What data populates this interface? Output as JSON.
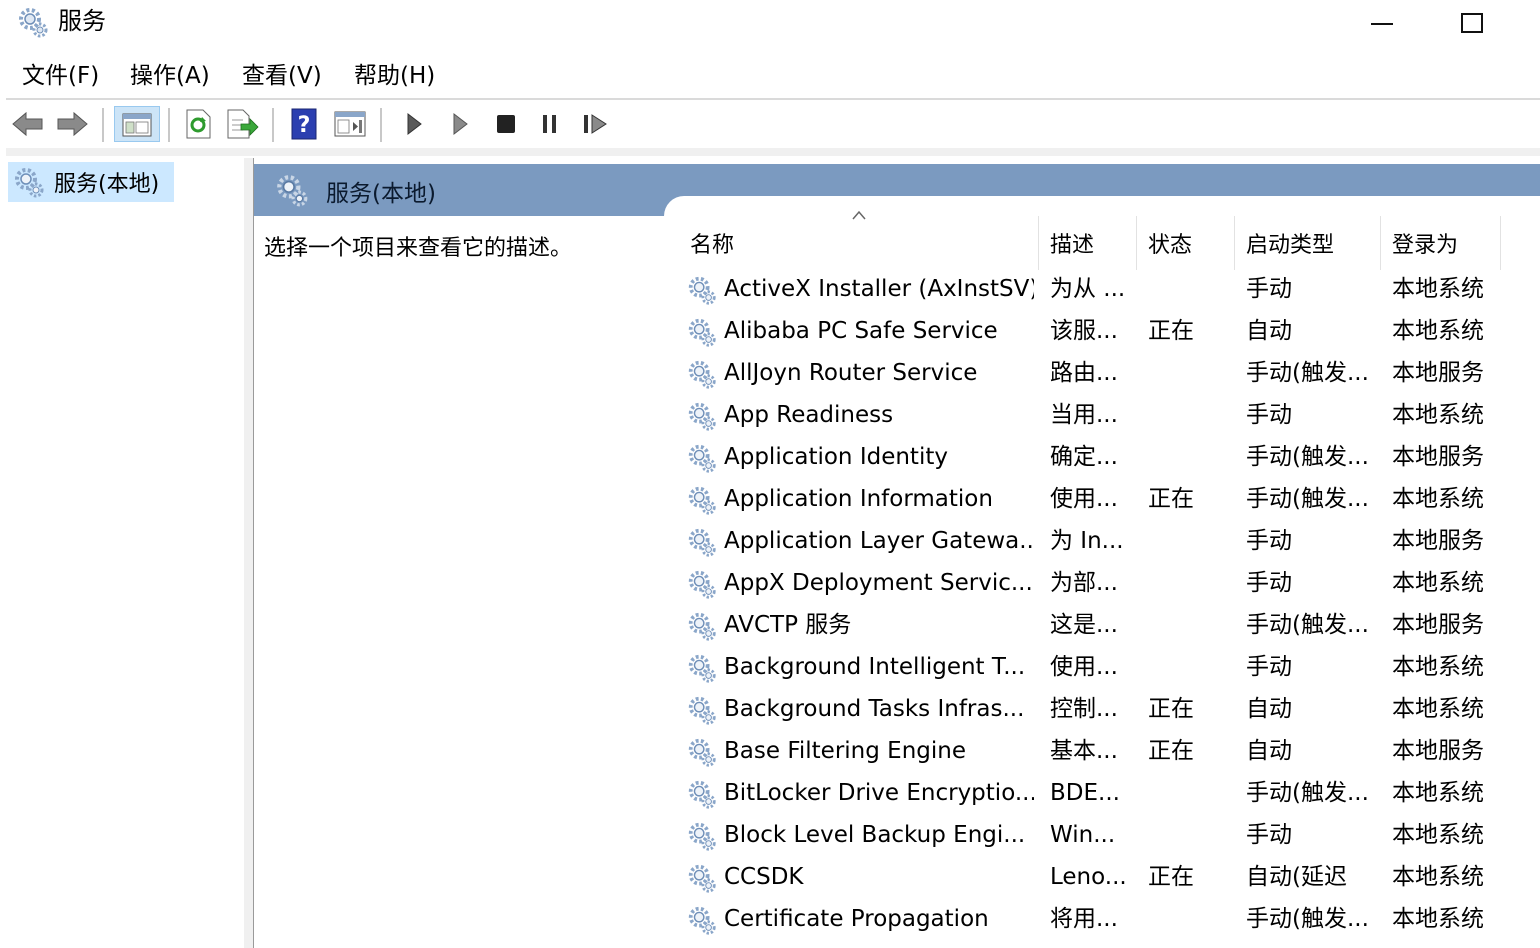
{
  "window": {
    "title": "服务",
    "icon": "gear-icon",
    "controls": [
      "minimize-icon",
      "maximize-icon"
    ]
  },
  "menu": {
    "items": [
      {
        "label": "文件(F)"
      },
      {
        "label": "操作(A)"
      },
      {
        "label": "查看(V)"
      },
      {
        "label": "帮助(H)"
      }
    ]
  },
  "toolbar": {
    "buttons": [
      "back-arrow-icon",
      "forward-arrow-icon",
      "show-hide-console-tree-icon",
      "refresh-icon",
      "export-list-icon",
      "help-icon",
      "properties-view-icon",
      "start-service-icon",
      "start-service-alt-icon",
      "stop-service-icon",
      "pause-service-icon",
      "resume-service-icon"
    ]
  },
  "tree": {
    "items": [
      {
        "label": "服务(本地)",
        "icon": "gear-icon",
        "selected": true
      }
    ]
  },
  "main": {
    "header_title": "服务(本地)",
    "description_hint": "选择一个项目来查看它的描述。",
    "columns": [
      "名称",
      "描述",
      "状态",
      "启动类型",
      "登录为"
    ],
    "rows": [
      {
        "name": "ActiveX Installer (AxInstSV)",
        "desc": "为从 ...",
        "status": "",
        "startup": "手动",
        "logon": "本地系统"
      },
      {
        "name": "Alibaba PC Safe Service",
        "desc": "该服...",
        "status": "正在",
        "startup": "自动",
        "logon": "本地系统"
      },
      {
        "name": "AllJoyn Router Service",
        "desc": "路由...",
        "status": "",
        "startup": "手动(触发...",
        "logon": "本地服务"
      },
      {
        "name": "App Readiness",
        "desc": "当用...",
        "status": "",
        "startup": "手动",
        "logon": "本地系统"
      },
      {
        "name": "Application Identity",
        "desc": "确定...",
        "status": "",
        "startup": "手动(触发...",
        "logon": "本地服务"
      },
      {
        "name": "Application Information",
        "desc": "使用...",
        "status": "正在",
        "startup": "手动(触发...",
        "logon": "本地系统"
      },
      {
        "name": "Application Layer Gatewa...",
        "desc": "为 In...",
        "status": "",
        "startup": "手动",
        "logon": "本地服务"
      },
      {
        "name": "AppX Deployment Servic...",
        "desc": "为部...",
        "status": "",
        "startup": "手动",
        "logon": "本地系统"
      },
      {
        "name": "AVCTP 服务",
        "desc": "这是...",
        "status": "",
        "startup": "手动(触发...",
        "logon": "本地服务"
      },
      {
        "name": "Background Intelligent T...",
        "desc": "使用...",
        "status": "",
        "startup": "手动",
        "logon": "本地系统"
      },
      {
        "name": "Background Tasks Infras...",
        "desc": "控制...",
        "status": "正在",
        "startup": "自动",
        "logon": "本地系统"
      },
      {
        "name": "Base Filtering Engine",
        "desc": "基本...",
        "status": "正在",
        "startup": "自动",
        "logon": "本地服务"
      },
      {
        "name": "BitLocker Drive Encryptio...",
        "desc": "BDE...",
        "status": "",
        "startup": "手动(触发...",
        "logon": "本地系统"
      },
      {
        "name": "Block Level Backup Engi...",
        "desc": "Win...",
        "status": "",
        "startup": "手动",
        "logon": "本地系统"
      },
      {
        "name": "CCSDK",
        "desc": "Leno...",
        "status": "正在",
        "startup": "自动(延迟",
        "logon": "本地系统"
      },
      {
        "name": "Certificate Propagation",
        "desc": "将用...",
        "status": "",
        "startup": "手动(触发...",
        "logon": "本地系统"
      }
    ]
  },
  "colors": {
    "header_band": "#7b9ac0",
    "selection": "#cce8ff",
    "gear": "#7f9fc7"
  }
}
